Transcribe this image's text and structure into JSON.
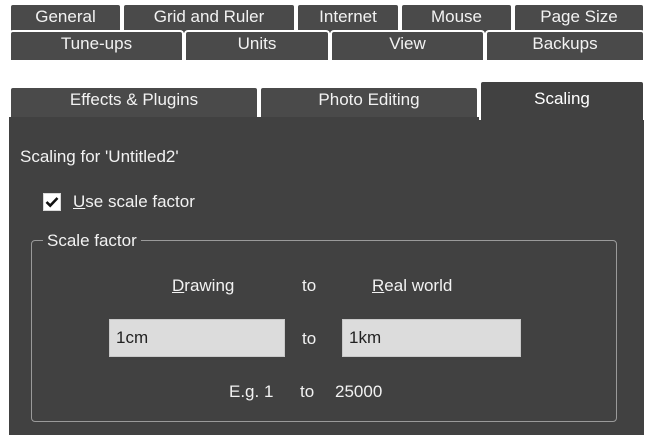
{
  "tabs": {
    "row1": [
      "General",
      "Grid and Ruler",
      "Internet",
      "Mouse",
      "Page Size"
    ],
    "row2": [
      "Tune-ups",
      "Units",
      "View",
      "Backups"
    ],
    "row3": [
      "Effects & Plugins",
      "Photo Editing",
      "Scaling"
    ],
    "selected": "Scaling"
  },
  "panel": {
    "heading": "Scaling for 'Untitled2'",
    "checkbox": {
      "mnemonic": "U",
      "rest": "se scale factor",
      "checked": true
    },
    "group": {
      "title": "Scale factor",
      "drawing_mnemonic": "D",
      "drawing_rest": "rawing",
      "to_label": "to",
      "real_mnemonic": "R",
      "real_rest": "eal world",
      "drawing_value": "1cm",
      "real_value": "1km",
      "example_prefix": "E.g. 1",
      "example_to": "to",
      "example_value": "25000"
    }
  }
}
